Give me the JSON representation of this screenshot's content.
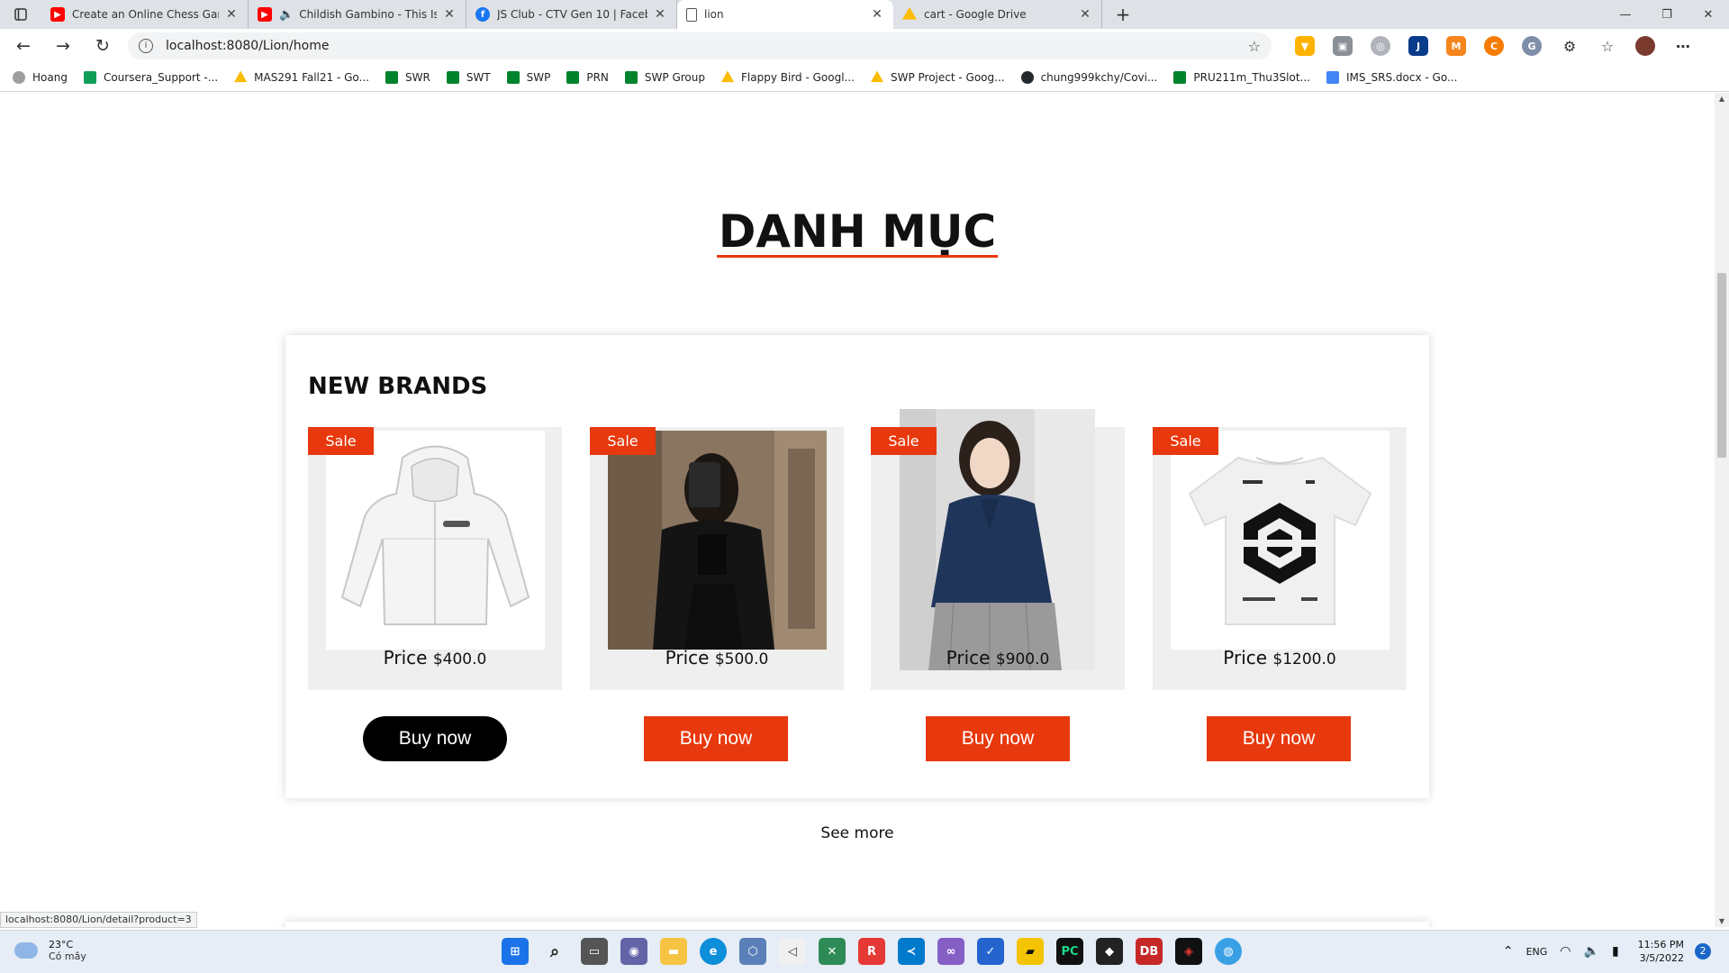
{
  "tabs": [
    {
      "title": "Create an Online Chess Game",
      "favicon": "youtube-icon",
      "color": "#ff0000"
    },
    {
      "title": "Childish Gambino - This Is Am",
      "favicon": "youtube-icon",
      "color": "#ff0000"
    },
    {
      "title": "JS Club - CTV Gen 10 | Facebook",
      "favicon": "facebook-icon",
      "color": "#1877f2"
    },
    {
      "title": "lion",
      "favicon": "page-icon",
      "color": "#ffffff"
    },
    {
      "title": "cart - Google Drive",
      "favicon": "drive-icon",
      "color": "#34a853"
    }
  ],
  "address": {
    "url": "localhost:8080/Lion/home"
  },
  "bookmarks": [
    {
      "label": "Hoang",
      "color": "#9e9e9e"
    },
    {
      "label": "Coursera_Support -...",
      "color": "#0f9d58"
    },
    {
      "label": "MAS291 Fall21 - Go...",
      "color": "#fbbc04"
    },
    {
      "label": "SWR",
      "color": "#00832d"
    },
    {
      "label": "SWT",
      "color": "#00832d"
    },
    {
      "label": "SWP",
      "color": "#00832d"
    },
    {
      "label": "PRN",
      "color": "#00832d"
    },
    {
      "label": "SWP Group",
      "color": "#00832d"
    },
    {
      "label": "Flappy Bird - Googl...",
      "color": "#fbbc04"
    },
    {
      "label": "SWP Project - Goog...",
      "color": "#fbbc04"
    },
    {
      "label": "chung999kchy/Covi...",
      "color": "#24292e"
    },
    {
      "label": "PRU211m_Thu3Slot...",
      "color": "#00832d"
    },
    {
      "label": "IMS_SRS.docx - Go...",
      "color": "#4285f4"
    }
  ],
  "page": {
    "section_title": "DANH MỤC",
    "card_heading": "NEW BRANDS",
    "see_more": "See more",
    "accent": "#e8380d",
    "products": [
      {
        "badge": "Sale",
        "price_label": "Price",
        "price_value": "$400.0",
        "button": "Buy now",
        "image": "white-hooded-jacket"
      },
      {
        "badge": "Sale",
        "price_label": "Price",
        "price_value": "$500.0",
        "button": "Buy now",
        "image": "black-leather-jacket-photo"
      },
      {
        "badge": "Sale",
        "price_label": "Price",
        "price_value": "$900.0",
        "button": "Buy now",
        "image": "navy-blouse-model-photo"
      },
      {
        "badge": "Sale",
        "price_label": "Price",
        "price_value": "$1200.0",
        "button": "Buy now",
        "image": "white-graphic-tshirt"
      }
    ]
  },
  "status_link": "localhost:8080/Lion/detail?product=3",
  "taskbar": {
    "weather_temp": "23°C",
    "weather_desc": "Có mây",
    "lang": "ENG",
    "time": "11:56 PM",
    "date": "3/5/2022",
    "notifications": "2"
  }
}
